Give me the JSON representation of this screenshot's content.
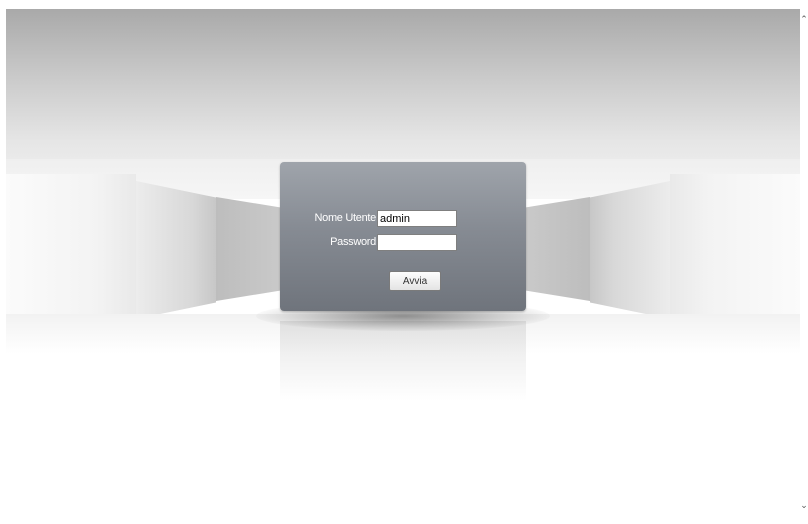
{
  "login": {
    "username_label": "Nome Utente",
    "username_value": "admin",
    "password_label": "Password",
    "password_value": "",
    "submit_label": "Avvia"
  },
  "scrollbar": {
    "up_icon": "chevron-up-icon",
    "down_icon": "chevron-down-icon"
  },
  "colors": {
    "panel_top": "#9fa4ab",
    "panel_bottom": "#6f747c",
    "label_text": "#ffffff"
  }
}
